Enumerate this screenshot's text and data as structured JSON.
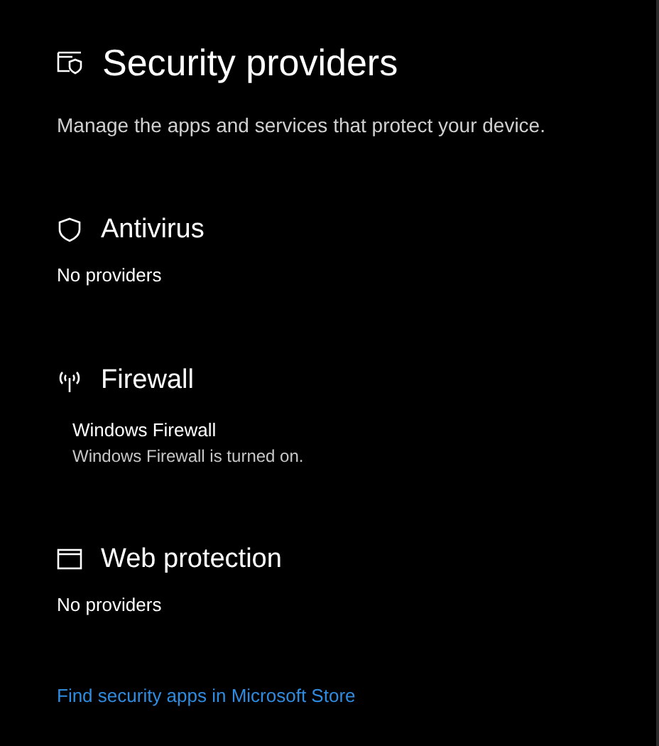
{
  "header": {
    "title": "Security providers",
    "description": "Manage the apps and services that protect your device."
  },
  "sections": [
    {
      "kind": "shield",
      "title": "Antivirus",
      "status": "No providers"
    },
    {
      "kind": "antenna",
      "title": "Firewall",
      "providers": [
        {
          "name": "Windows Firewall",
          "detail": "Windows Firewall is turned on."
        }
      ]
    },
    {
      "kind": "browser",
      "title": "Web protection",
      "status": "No providers"
    }
  ],
  "link": "Find security apps in Microsoft Store"
}
